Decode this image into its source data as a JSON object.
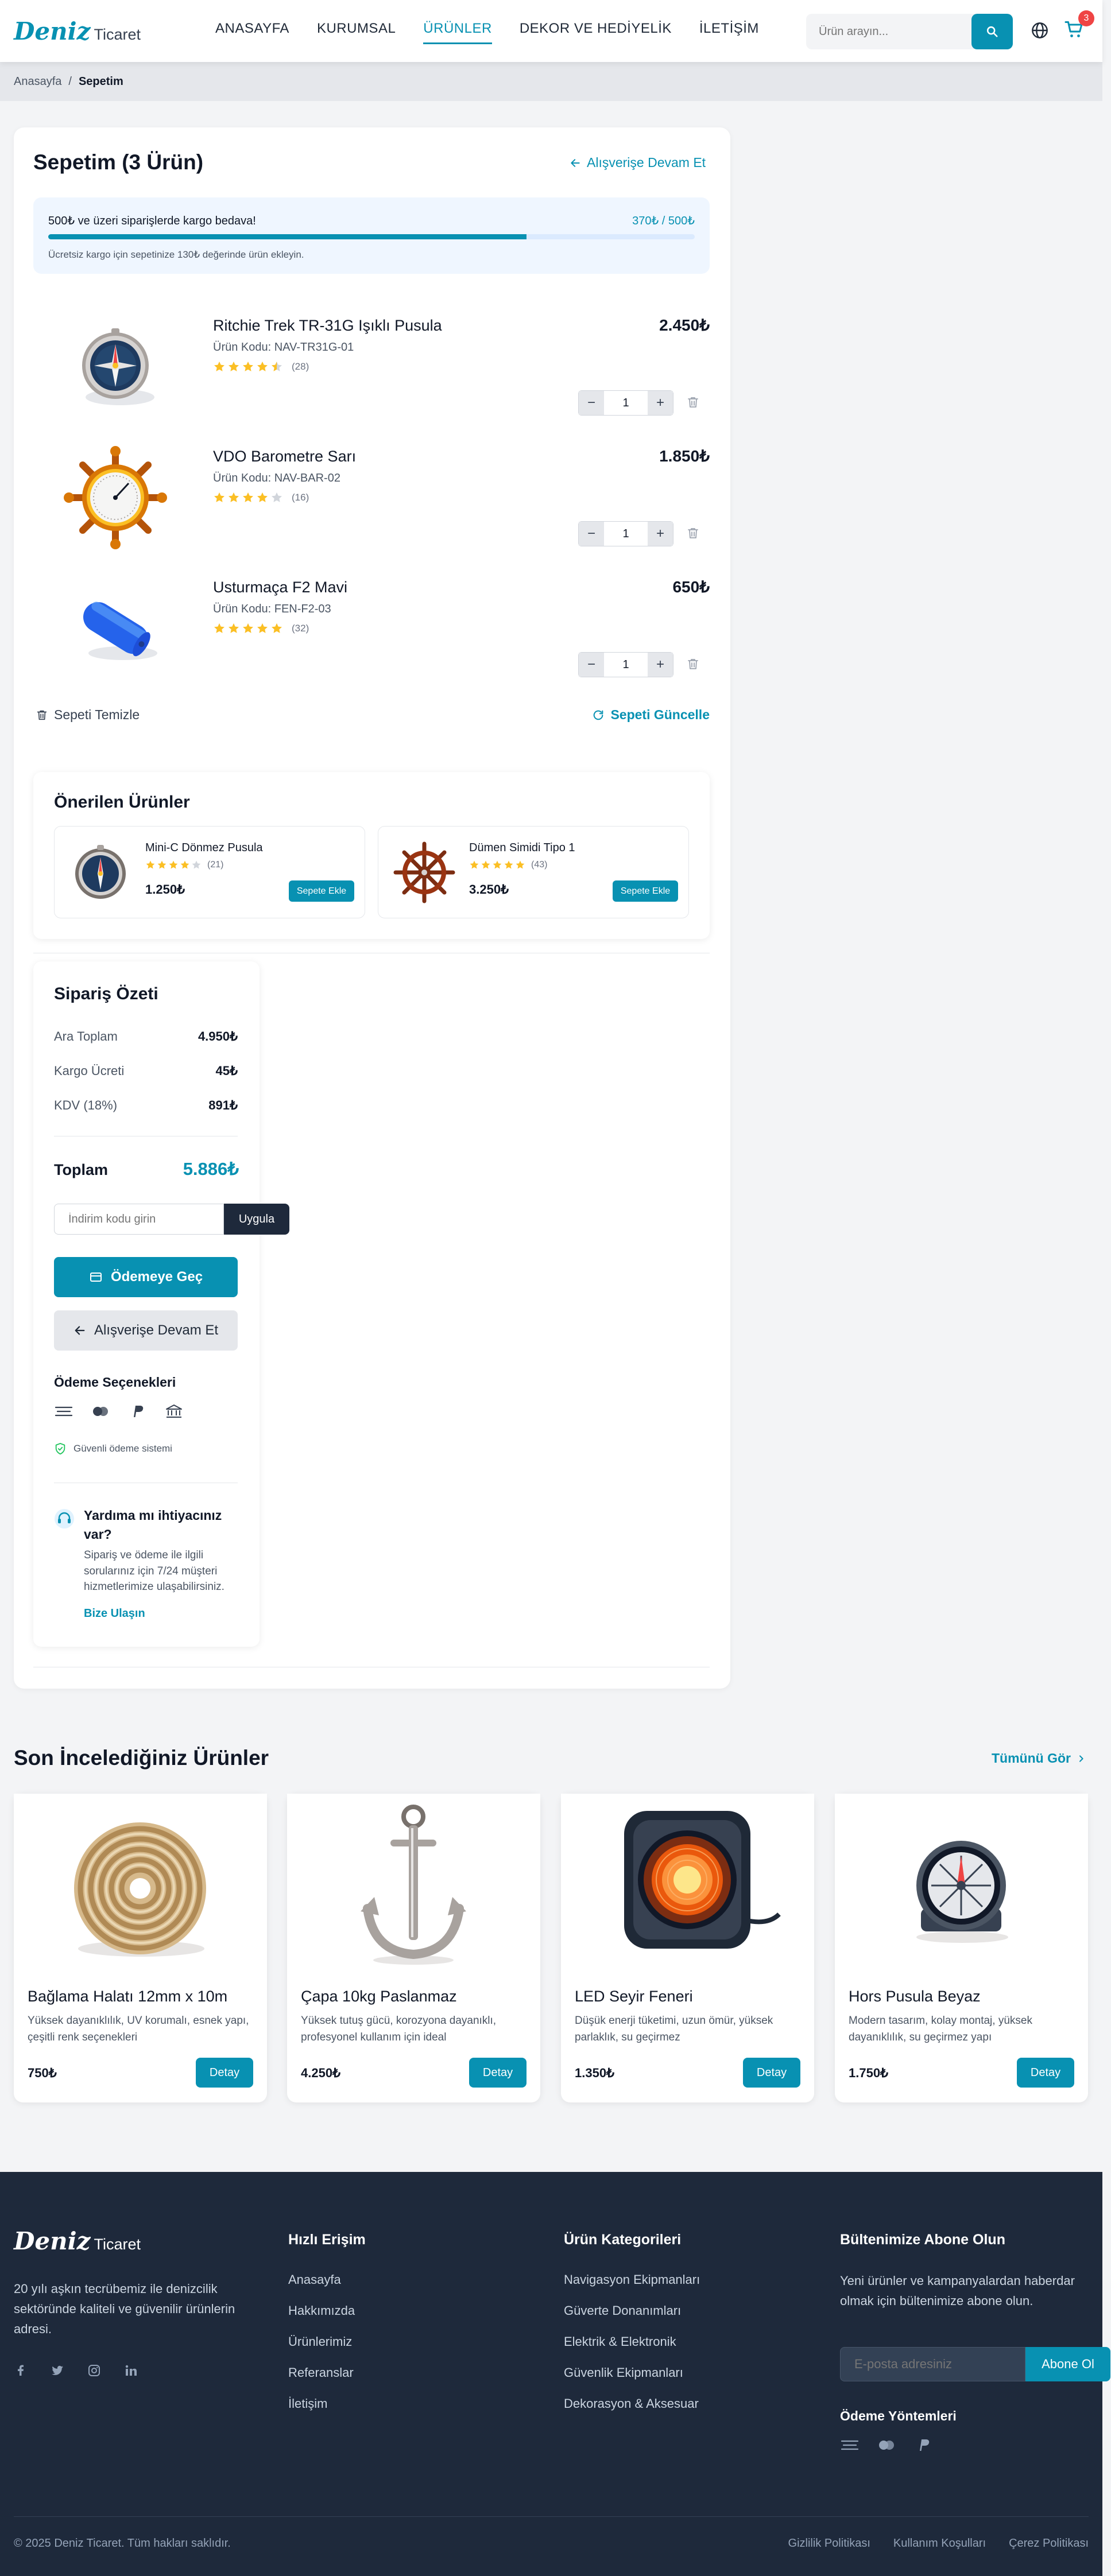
{
  "brand": {
    "name": "Deniz",
    "suffix": "Ticaret"
  },
  "nav": [
    {
      "label": "ANASAYFA",
      "active": false
    },
    {
      "label": "KURUMSAL",
      "active": false
    },
    {
      "label": "ÜRÜNLER",
      "active": true
    },
    {
      "label": "DEKOR VE HEDİYELİK",
      "active": false
    },
    {
      "label": "İLETİŞİM",
      "active": false
    }
  ],
  "search": {
    "placeholder": "Ürün arayın..."
  },
  "cart_badge": "3",
  "breadcrumb": {
    "home": "Anasayfa",
    "separator": "/",
    "current": "Sepetim"
  },
  "cart": {
    "title": "Sepetim (3 Ürün)",
    "continue_label": "Alışverişe Devam Et",
    "shipping": {
      "message": "500₺ ve üzeri siparişlerde kargo bedava!",
      "progress_text": "370₺ / 500₺",
      "progress_fraction": 0.74,
      "note": "Ücretsiz kargo için sepetinize 130₺ değerinde ürün ekleyin."
    },
    "items": [
      {
        "name": "Ritchie Trek TR-31G Işıklı Pusula",
        "code": "Ürün Kodu: NAV-TR31G-01",
        "rating": 4.5,
        "reviews": "(28)",
        "price": "2.450₺",
        "qty": "1",
        "image": "compass-image"
      },
      {
        "name": "VDO Barometre Sarı",
        "code": "Ürün Kodu: NAV-BAR-02",
        "rating": 4,
        "reviews": "(16)",
        "price": "1.850₺",
        "qty": "1",
        "image": "barometer-image"
      },
      {
        "name": "Usturmaça F2 Mavi",
        "code": "Ürün Kodu: FEN-F2-03",
        "rating": 5,
        "reviews": "(32)",
        "price": "650₺",
        "qty": "1",
        "image": "fender-image"
      }
    ],
    "clear_label": "Sepeti Temizle",
    "update_label": "Sepeti Güncelle"
  },
  "recommended": {
    "title": "Önerilen Ürünler",
    "add_label": "Sepete Ekle",
    "items": [
      {
        "name": "Mini-C Dönmez Pusula",
        "rating": 4,
        "reviews": "(21)",
        "price": "1.250₺"
      },
      {
        "name": "Dümen Simidi Tipo 1",
        "rating": 5,
        "reviews": "(43)",
        "price": "3.250₺"
      }
    ]
  },
  "summary": {
    "title": "Sipariş Özeti",
    "rows": [
      {
        "label": "Ara Toplam",
        "value": "4.950₺"
      },
      {
        "label": "Kargo Ücreti",
        "value": "45₺"
      },
      {
        "label": "KDV (18%)",
        "value": "891₺"
      }
    ],
    "total_label": "Toplam",
    "total_value": "5.886₺",
    "coupon_placeholder": "İndirim kodu girin",
    "coupon_button": "Uygula",
    "pay_button": "Ödemeye Geç",
    "continue_button": "Alışverişe Devam Et",
    "payment_options_title": "Ödeme Seçenekleri",
    "secure_text": "Güvenli ödeme sistemi",
    "help": {
      "title": "Yardıma mı ihtiyacınız var?",
      "text": "Sipariş ve ödeme ile ilgili sorularınız için 7/24 müşteri hizmetlerimize ulaşabilirsiniz.",
      "link": "Bize Ulaşın"
    }
  },
  "recent": {
    "title": "Son İncelediğiniz Ürünler",
    "see_all": "Tümünü Gör",
    "detail_label": "Detay",
    "items": [
      {
        "name": "Bağlama Halatı 12mm x 10m",
        "desc": "Yüksek dayanıklılık, UV korumalı, esnek yapı, çeşitli renk seçenekleri",
        "price": "750₺"
      },
      {
        "name": "Çapa 10kg Paslanmaz",
        "desc": "Yüksek tutuş gücü, korozyona dayanıklı, profesyonel kullanım için ideal",
        "price": "4.250₺"
      },
      {
        "name": "LED Seyir Feneri",
        "desc": "Düşük enerji tüketimi, uzun ömür, yüksek parlaklık, su geçirmez",
        "price": "1.350₺"
      },
      {
        "name": "Hors Pusula Beyaz",
        "desc": "Modern tasarım, kolay montaj, yüksek dayanıklılık, su geçirmez yapı",
        "price": "1.750₺"
      }
    ]
  },
  "footer": {
    "about": "20 yılı aşkın tecrübemiz ile denizcilik sektöründe kaliteli ve güvenilir ürünlerin adresi.",
    "quick_title": "Hızlı Erişim",
    "quick_links": [
      "Anasayfa",
      "Hakkımızda",
      "Ürünlerimiz",
      "Referanslar",
      "İletişim"
    ],
    "cat_title": "Ürün Kategorileri",
    "cat_links": [
      "Navigasyon Ekipmanları",
      "Güverte Donanımları",
      "Elektrik & Elektronik",
      "Güvenlik Ekipmanları",
      "Dekorasyon & Aksesuar"
    ],
    "newsletter_title": "Bültenimize Abone Olun",
    "newsletter_text": "Yeni ürünler ve kampanyalardan haberdar olmak için bültenimize abone olun.",
    "email_placeholder": "E-posta adresiniz",
    "subscribe": "Abone Ol",
    "payment_title": "Ödeme Yöntemleri",
    "copyright": "© 2025 Deniz Ticaret. Tüm hakları saklıdır.",
    "legal": [
      "Gizlilik Politikası",
      "Kullanım Koşulları",
      "Çerez Politikası"
    ]
  },
  "colors": {
    "accent": "#0891b2",
    "dark": "#1e293b",
    "star": "#fbbf24",
    "badge": "#ef4444"
  }
}
